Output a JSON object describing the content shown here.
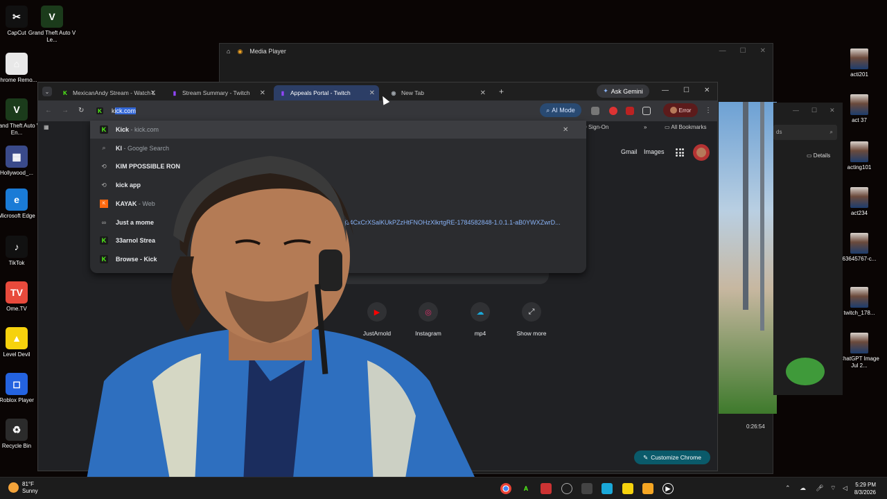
{
  "desktop_left": [
    {
      "label": "CapCut",
      "glyph": "✂",
      "color": "#111111"
    },
    {
      "label": "Chrome Remo...",
      "glyph": "⌂",
      "color": "#e8e8e8"
    },
    {
      "label": "Grand Theft Auto V En...",
      "glyph": "V",
      "color": "#1b3b1b"
    },
    {
      "label": "Hollywood_...",
      "glyph": "▦",
      "color": "#3a4a8a"
    },
    {
      "label": "Microsoft Edge",
      "glyph": "e",
      "color": "#1a7bd6"
    },
    {
      "label": "TikTok",
      "glyph": "♪",
      "color": "#111111"
    },
    {
      "label": "Ome.TV",
      "glyph": "TV",
      "color": "#e84a3c"
    },
    {
      "label": "Level Devil",
      "glyph": "▲",
      "color": "#f6d20d"
    },
    {
      "label": "Roblox Player",
      "glyph": "◻",
      "color": "#2463e0"
    },
    {
      "label": "Recycle Bin",
      "glyph": "♻",
      "color": "#2b2b2b"
    }
  ],
  "desktop_left2": [
    {
      "label": "Grand Theft Auto V Le...",
      "glyph": "V",
      "color": "#1b3b1b"
    }
  ],
  "desktop_right": [
    {
      "label": "acti201"
    },
    {
      "label": "act 37"
    },
    {
      "label": "acting101"
    },
    {
      "label": "act234"
    },
    {
      "label": "63645767-c..."
    },
    {
      "label": "twitch_178..."
    },
    {
      "label": "ChatGPT Image Jul 2..."
    }
  ],
  "media_player": {
    "title": "Media Player",
    "time": "0:26:54"
  },
  "side_panel": {
    "search_placeholder": "ds",
    "details": "Details"
  },
  "chrome": {
    "tabs": [
      {
        "title": "MexicanAndy Stream - Watch L",
        "icon": "K",
        "icon_color": "#53fc18"
      },
      {
        "title": "Stream Summary - Twitch",
        "icon": "▮",
        "icon_color": "#9146ff"
      },
      {
        "title": "Appeals Portal - Twitch",
        "icon": "▮",
        "icon_color": "#9146ff"
      },
      {
        "title": "New Tab",
        "icon": "◉",
        "icon_color": "#9aa0a6"
      }
    ],
    "new_tab": "+",
    "ask_gemini": "Ask Gemini",
    "omnibox": {
      "typed": "k",
      "completion": "ick.com"
    },
    "ai_mode": "AI Mode",
    "profile_status": "Error",
    "bookmarks": {
      "sign_on": "D Sign-On",
      "all": "All Bookmarks"
    },
    "suggestions": [
      {
        "type": "kick",
        "bold": "Kick",
        "rest": " - kick.com"
      },
      {
        "type": "search",
        "bold": "KI",
        "rest": " - Google Search"
      },
      {
        "type": "history",
        "bold": "KIM PPOSSIBLE RON",
        "rest": ""
      },
      {
        "type": "history",
        "bold": "kick app",
        "rest": ""
      },
      {
        "type": "kayak",
        "bold": "KAYAK",
        "rest": " - Web"
      },
      {
        "type": "web",
        "bold": "Just a mome",
        "rest": "",
        "url": "46mllj34CxCrXSalKUkPZzHtFNOHzXlkrtgRE-1784582848-1.0.1.1-aB0YWXZwrD..."
      },
      {
        "type": "kick",
        "bold": "33arnol Strea",
        "rest": ""
      },
      {
        "type": "kick",
        "bold": "Browse - Kick",
        "rest": ""
      }
    ],
    "ntp": {
      "gmail": "Gmail",
      "images": "Images",
      "shortcuts": [
        {
          "label": "JustArnold",
          "glyph": "▶",
          "color": "#ff0000"
        },
        {
          "label": "Instagram",
          "glyph": "◎",
          "color": "#e1306c"
        },
        {
          "label": "mp4",
          "glyph": "☁",
          "color": "#1aa8d8"
        },
        {
          "label": "Show more",
          "glyph": "⤢",
          "color": "#e8eaed"
        }
      ],
      "customize": "Customize Chrome"
    }
  },
  "taskbar": {
    "temp": "81°F",
    "weather": "Sunny",
    "time": "5:29 PM",
    "date": "8/3/2026"
  }
}
